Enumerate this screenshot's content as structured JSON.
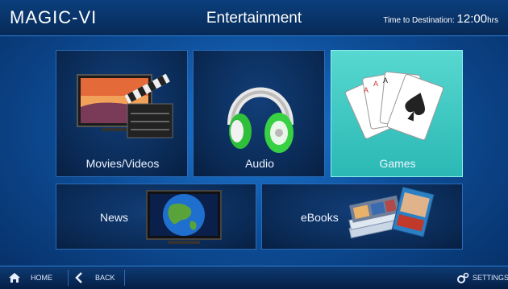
{
  "header": {
    "brand": "MAGIC-VI",
    "title": "Entertainment",
    "eta_label": "Time to Destination:",
    "eta_time": "12:00",
    "eta_unit": "hrs"
  },
  "tiles": [
    {
      "label": "Movies/Videos",
      "icon": "movie-clapperboard-icon"
    },
    {
      "label": "Audio",
      "icon": "headphones-icon"
    },
    {
      "label": "Games",
      "icon": "playing-cards-icon",
      "active": true
    },
    {
      "label": "News",
      "icon": "globe-monitor-icon"
    },
    {
      "label": "eBooks",
      "icon": "books-icon"
    }
  ],
  "footer": {
    "home_label": "HOME",
    "back_label": "BACK",
    "settings_label": "SETTINGS"
  },
  "colors": {
    "active_tile": "#3ec8c2",
    "background": "#0e4f9a",
    "bar": "#072a57"
  }
}
